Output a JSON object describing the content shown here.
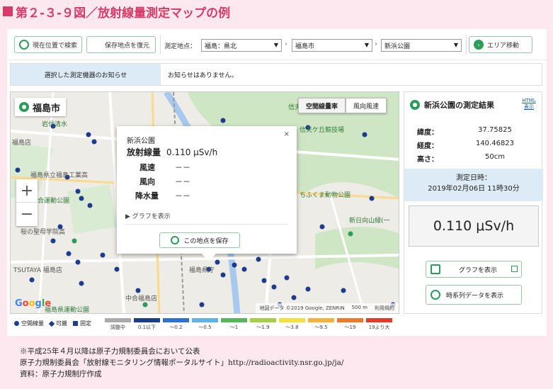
{
  "figure_title": "第２-３-９図／放射線量測定マップの例",
  "toolbar": {
    "current_location_label": "現在位置で検索",
    "saved_location_label": "保存地点を復元",
    "measure_point_label": "測定地点：",
    "region_select": "福島：県北",
    "city_select": "福島市",
    "place_select": "新浜公園",
    "area_move_label": "エリア移動"
  },
  "notice": {
    "title": "選択した測定機器のお知らせ",
    "message": "お知らせはありません。"
  },
  "map": {
    "city_name": "福島市",
    "tab_air_dose": "空間線量率",
    "tab_wind": "風向風速",
    "zoom_in": "+",
    "zoom_out": "−",
    "labels": {
      "l1": "信夫",
      "l2": "岩代清水",
      "l3": "福島店",
      "l4": "福島県立福島工業高",
      "l5": "合運動公園",
      "l6": "桜の聖母学院高",
      "l7": "TSUTAYA 福島店",
      "l8": "福島県",
      "l9": "十六沼公園",
      "l10": "県立福島北高",
      "l11": "信夫ケ丘競技場",
      "l12": "ふくしま",
      "l13": "新日向山",
      "l14": "日野台",
      "l15": "福島市",
      "l16": "西公園",
      "l17": "ちふくま動物公園",
      "l18": "新日向山緑(一",
      "l19": "福島県運動公園",
      "l20": "コストコ",
      "l21": "中合福島店",
      "l22": "福島",
      "l23": "南町",
      "l24": "中島",
      "l25": "福島市体育館",
      "l26": "原町",
      "l27": "370",
      "l28": "4",
      "l29": "4",
      "l30": "福島県庁",
      "l31": "福島"
    },
    "google": "Google",
    "attribution_data": "地図データ ©2019 Google, ZENRIN",
    "attribution_scale": "500 m",
    "attribution_terms": "利用規約"
  },
  "popup": {
    "place": "新浜公園",
    "dose_label": "放射線量",
    "dose_value": "0.110 μSv/h",
    "wind_speed_label": "風速",
    "wind_speed_value": "－－",
    "wind_dir_label": "風向",
    "wind_dir_value": "－－",
    "rain_label": "降水量",
    "rain_value": "－－",
    "graph_link": "▶ グラフを表示",
    "save_button": "この地点を保存",
    "close": "×"
  },
  "result": {
    "title": "新浜公園の測定結果",
    "html_link": "HTML 表示",
    "lat_label": "緯度：",
    "lat_value": "37.75825",
    "lon_label": "経度：",
    "lon_value": "140.46823",
    "alt_label": "高さ：",
    "alt_value": "50cm",
    "time_label": "測定日時：",
    "time_value": "2019年02月06日 11時30分",
    "dose": "0.110 μSv/h",
    "graph_button": "グラフを表示",
    "timeseries_button": "時系列データを表示"
  },
  "legend": {
    "types": [
      "空間線量",
      "可搬",
      "固定"
    ],
    "ranges": [
      {
        "label": "調整中",
        "color": "#aaaaaa"
      },
      {
        "label": "0.1以下",
        "color": "#1d3c8e"
      },
      {
        "label": "～0.2",
        "color": "#2e6fd1"
      },
      {
        "label": "～0.5",
        "color": "#5fb2ea"
      },
      {
        "label": "～1",
        "color": "#54b85a"
      },
      {
        "label": "～1.9",
        "color": "#a7cf45"
      },
      {
        "label": "～3.8",
        "color": "#f3e03b"
      },
      {
        "label": "～9.5",
        "color": "#f6b13a"
      },
      {
        "label": "～19",
        "color": "#ee7a2c"
      },
      {
        "label": "19より大",
        "color": "#e23a2b"
      }
    ]
  },
  "footnotes": {
    "line1": "※平成25年４月以降は原子力規制委員会において公表",
    "line2": "原子力規制委員会「放射線モニタリング情報ポータルサイト」http://radioactivity.nsr.go.jp/ja/",
    "line3": "資料：原子力規制庁作成"
  }
}
